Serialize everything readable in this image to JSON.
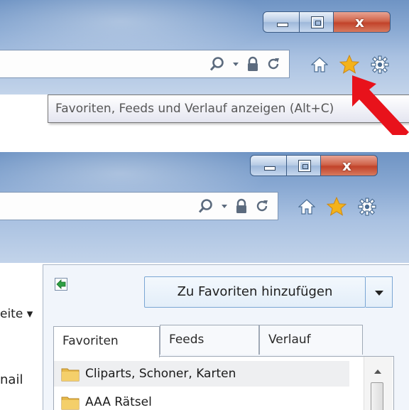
{
  "window_controls": {
    "minimize": "minimize",
    "maximize": "maximize",
    "close": "x"
  },
  "tooltip": {
    "text": "Favoriten, Feeds und Verlauf anzeigen (Alt+C)"
  },
  "toolbar_icons": [
    "search-icon",
    "dropdown-arrow-icon",
    "lock-icon",
    "refresh-icon",
    "home-icon",
    "star-icon",
    "gear-icon"
  ],
  "colors": {
    "star": "#f3b21a",
    "arrow": "#e8121b",
    "close": "#c9472f"
  },
  "favorites_panel": {
    "add_button": "Zu Favoriten hinzufügen",
    "tabs": [
      {
        "label": "Favoriten",
        "active": true
      },
      {
        "label": "Feeds",
        "active": false
      },
      {
        "label": "Verlauf",
        "active": false
      }
    ],
    "items": [
      {
        "label": "Cliparts, Schoner, Karten",
        "selected": true
      },
      {
        "label": "AAA Rätsel",
        "selected": false
      }
    ]
  },
  "page_fragments": {
    "left_1": "eite ▾",
    "left_2": "nail"
  }
}
